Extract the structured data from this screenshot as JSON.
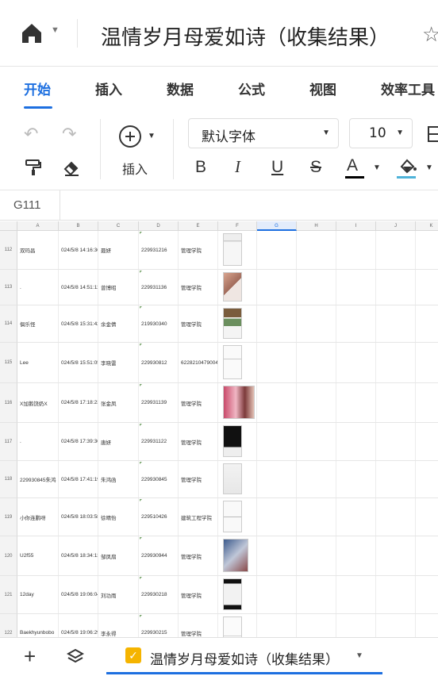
{
  "app": {
    "title": "温情岁月母爱如诗（收集结果）"
  },
  "tabs": [
    "开始",
    "插入",
    "数据",
    "公式",
    "视图",
    "效率工具"
  ],
  "toolbar": {
    "insert_label": "插入",
    "font_name": "默认字体",
    "font_size": "10",
    "bold": "B",
    "italic": "I",
    "underline": "U",
    "strike": "S",
    "font_color_letter": "A",
    "font_color": "#000000",
    "fill_color": "#4fb3d9"
  },
  "name_box": "G111",
  "columns": [
    "A",
    "B",
    "C",
    "D",
    "E",
    "F",
    "G",
    "H",
    "I",
    "J",
    "K"
  ],
  "selected_column": "G",
  "rows": [
    {
      "num": "112",
      "a": "双玛昌",
      "b": "024/5/8 14:16:36",
      "c": "聂妍",
      "d": "229931216",
      "e": "管理学院"
    },
    {
      "num": "113",
      "a": ".",
      "b": "024/5/8 14:51:11",
      "c": "曾博昭",
      "d": "229931136",
      "e": "管理学院"
    },
    {
      "num": "114",
      "a": "俱乐怪",
      "b": "024/5/8 15:31:42",
      "c": "余金倩",
      "d": "219930340",
      "e": "管理学院"
    },
    {
      "num": "115",
      "a": "Lee",
      "b": "024/5/8 15:51:05",
      "c": "李晓雷",
      "d": "229930812",
      "e": "6228210479004"
    },
    {
      "num": "116",
      "a": "X加鹅饶奶X",
      "b": "024/5/8 17:18:23",
      "c": "张金凤",
      "d": "229931139",
      "e": "管理学院"
    },
    {
      "num": "117",
      "a": ".",
      "b": "024/5/8 17:39:36",
      "c": "唐妍",
      "d": "229931122",
      "e": "管理学院"
    },
    {
      "num": "118",
      "a": "229930845朱鸿",
      "b": "024/5/8 17:41:19",
      "c": "朱鸿函",
      "d": "229930845",
      "e": "管理学院"
    },
    {
      "num": "119",
      "a": "小你连鹏呀",
      "b": "024/5/8 18:03:58",
      "c": "徐晴怡",
      "d": "229510426",
      "e": "建筑工程学院"
    },
    {
      "num": "120",
      "a": "U2f55",
      "b": "024/5/8 18:34:13",
      "c": "邹凤扇",
      "d": "229930944",
      "e": "管理学院"
    },
    {
      "num": "121",
      "a": "12day",
      "b": "024/5/8 19:06:04",
      "c": "刘功雨",
      "d": "229930218",
      "e": "管理学院"
    },
    {
      "num": "122",
      "a": "Baekhyunbobo",
      "b": "024/5/8 19:06:29",
      "c": "李永得",
      "d": "229930215",
      "e": "管理学院"
    }
  ],
  "sheet_tab": "温情岁月母爱如诗（收集结果）"
}
